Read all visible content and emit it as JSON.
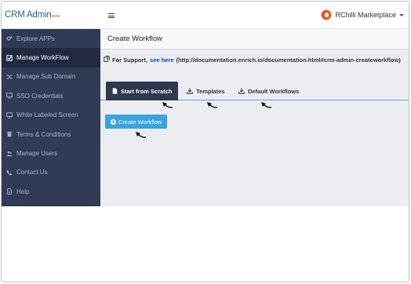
{
  "header": {
    "brand_name": "CRM Admin",
    "brand_tag": "beta",
    "user_name": "RChilli Marketplace"
  },
  "sidebar": {
    "items": [
      {
        "label": "Explore APPs",
        "icon": "gears-icon",
        "active": false
      },
      {
        "label": "Manage WorkFlow",
        "icon": "check-square-icon",
        "active": true
      },
      {
        "label": "Manage Sub Domain",
        "icon": "shuffle-icon",
        "active": false
      },
      {
        "label": "SSO Credentials",
        "icon": "monitor-icon",
        "active": false
      },
      {
        "label": "White Labeled Screen",
        "icon": "monitor-icon",
        "active": false
      },
      {
        "label": "Terms & Conditions",
        "icon": "book-icon",
        "active": false
      },
      {
        "label": "Manage Users",
        "icon": "users-icon",
        "active": false
      },
      {
        "label": "Contact Us",
        "icon": "phone-icon",
        "active": false
      },
      {
        "label": "Help",
        "icon": "file-icon",
        "active": false
      }
    ]
  },
  "main": {
    "title": "Create Workflow",
    "support": {
      "prefix": "For Support,",
      "link_text": "see here",
      "url_text": "(http://documentation.enrich.io/documentation.html#crm-admin-createworkflow)"
    },
    "tabs": [
      {
        "label": "Start from Scratch",
        "icon": "file-icon",
        "active": true
      },
      {
        "label": "Templates",
        "icon": "download-icon",
        "active": false
      },
      {
        "label": "Default Workflows",
        "icon": "download-icon",
        "active": false
      }
    ],
    "create_button": "Create Workflow"
  },
  "colors": {
    "sidebar_bg": "#313b56",
    "sidebar_active": "#212a40",
    "tab_active": "#2e3850",
    "accent": "#3aa4de",
    "link": "#0b3fd6"
  }
}
